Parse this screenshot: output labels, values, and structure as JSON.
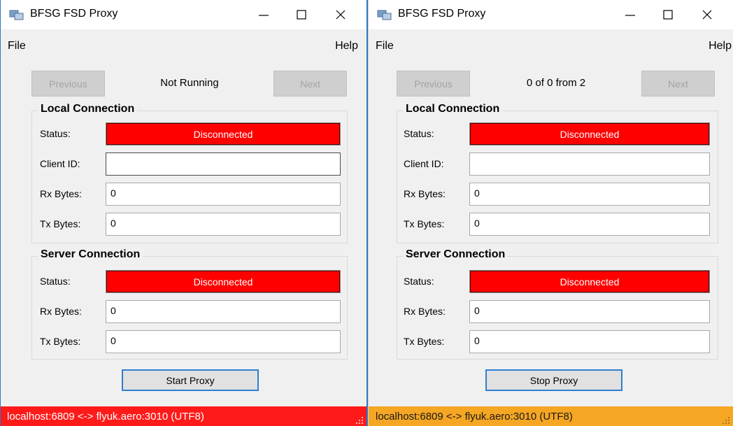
{
  "windows": [
    {
      "title": "BFSG FSD Proxy",
      "menu": {
        "file": "File",
        "help": "Help"
      },
      "nav": {
        "previous": "Previous",
        "status": "Not Running",
        "next": "Next"
      },
      "local": {
        "heading": "Local Connection",
        "status_label": "Status:",
        "status_value": "Disconnected",
        "client_label": "Client ID:",
        "client_value": "",
        "rx_label": "Rx Bytes:",
        "rx_value": "0",
        "tx_label": "Tx Bytes:",
        "tx_value": "0"
      },
      "server": {
        "heading": "Server Connection",
        "status_label": "Status:",
        "status_value": "Disconnected",
        "rx_label": "Rx Bytes:",
        "rx_value": "0",
        "tx_label": "Tx Bytes:",
        "tx_value": "0"
      },
      "proxy_button": "Start Proxy",
      "statusbar": "localhost:6809  <->  flyuk.aero:3010 (UTF8)",
      "statusbar_color": "#ff1a1a"
    },
    {
      "title": "BFSG FSD Proxy",
      "menu": {
        "file": "File",
        "help": "Help"
      },
      "nav": {
        "previous": "Previous",
        "status": "0 of 0 from 2",
        "next": "Next"
      },
      "local": {
        "heading": "Local Connection",
        "status_label": "Status:",
        "status_value": "Disconnected",
        "client_label": "Client ID:",
        "client_value": "",
        "rx_label": "Rx Bytes:",
        "rx_value": "0",
        "tx_label": "Tx Bytes:",
        "tx_value": "0"
      },
      "server": {
        "heading": "Server Connection",
        "status_label": "Status:",
        "status_value": "Disconnected",
        "rx_label": "Rx Bytes:",
        "rx_value": "0",
        "tx_label": "Tx Bytes:",
        "tx_value": "0"
      },
      "proxy_button": "Stop Proxy",
      "statusbar": "localhost:6809  <->  flyuk.aero:3010 (UTF8)",
      "statusbar_color": "#f5a623"
    }
  ],
  "colors": {
    "disconnected": "#ff0000",
    "window_border_active": "#2b79c2",
    "button_border_focus": "#2f7fd0"
  },
  "icons": [
    "app-icon",
    "minimize-icon",
    "maximize-icon",
    "close-icon",
    "resize-grip-icon"
  ]
}
